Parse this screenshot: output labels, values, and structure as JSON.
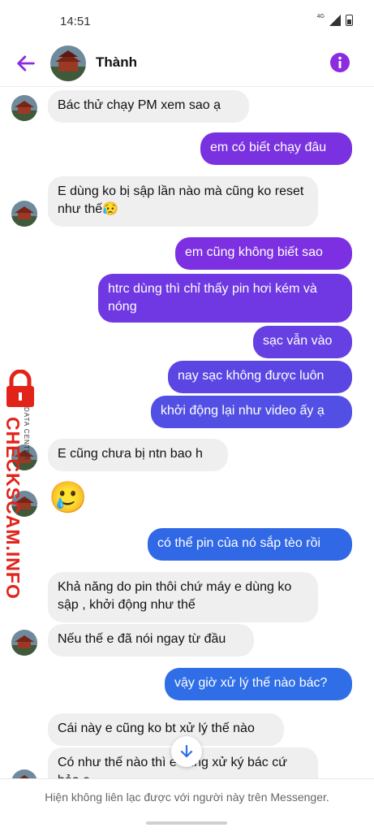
{
  "status": {
    "time": "14:51",
    "network": "4G"
  },
  "header": {
    "name": "Thành"
  },
  "colors": {
    "accent": "#8b2be2",
    "out_purple": "#7a32e0",
    "out_blue": "#3068e6",
    "in_bg": "#efefef"
  },
  "messages": [
    {
      "dir": "in",
      "text": "Bác thử chạy PM xem sao ạ"
    },
    {
      "dir": "out",
      "text": "em có biết chạy đâu"
    },
    {
      "dir": "in",
      "text": "E dùng ko bị sập lần nào mà cũng ko reset như thế😥"
    },
    {
      "dir": "out",
      "text": "em cũng không biết sao"
    },
    {
      "dir": "out",
      "text": "htrc dùng thì chỉ thấy pin hơi kém và nóng"
    },
    {
      "dir": "out",
      "text": "sạc vẫn vào"
    },
    {
      "dir": "out",
      "text": "nay sạc không được luôn"
    },
    {
      "dir": "out",
      "text": "khởi động lại như video ấy ạ"
    },
    {
      "dir": "in",
      "text": "E cũng chưa bị ntn bao h"
    },
    {
      "dir": "in",
      "text": "🥲"
    },
    {
      "dir": "out",
      "text": "có thể pin của nó sắp tèo rồi"
    },
    {
      "dir": "in",
      "text": "Khả năng do pin thôi chứ máy e dùng ko sập , khởi động như thế"
    },
    {
      "dir": "in",
      "text": "Nếu thế e đã nói ngay từ đầu"
    },
    {
      "dir": "out",
      "text": "vậy giờ xử lý thế nào bác?"
    },
    {
      "dir": "in",
      "text": "Cái này e cũng ko bt xử lý thế nào"
    },
    {
      "dir": "in",
      "text": "Có như thế nào thì e cũng xử ký bác cứ bảo e"
    }
  ],
  "footer": {
    "notice": "Hiện không liên lạc được với người này trên Messenger."
  },
  "watermark": {
    "brand": "CHECKSCAM.INFO",
    "sub": "DATA CENTER"
  }
}
